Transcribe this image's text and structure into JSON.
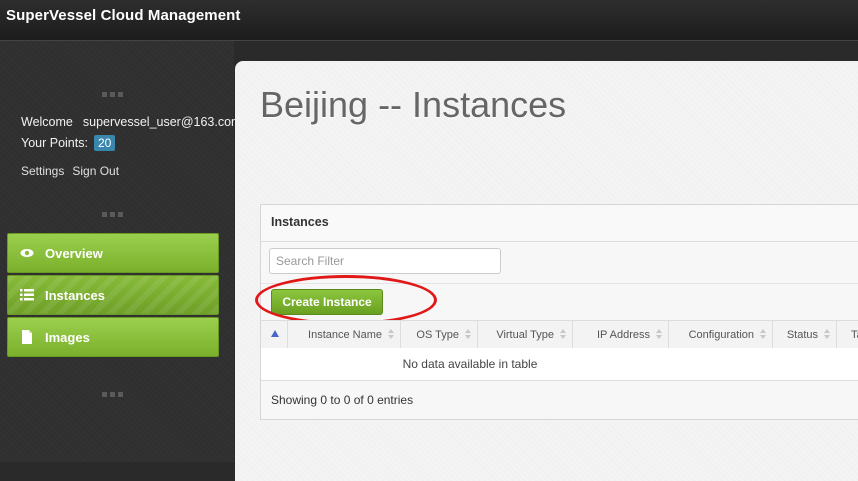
{
  "app": {
    "title": "SuperVessel Cloud Management"
  },
  "sidebar": {
    "welcome_label": "Welcome",
    "username": "supervessel_user@163.com",
    "points_label": "Your Points:",
    "points_value": "20",
    "settings_label": "Settings",
    "signout_label": "Sign Out",
    "nav": [
      {
        "label": "Overview",
        "icon": "eye-icon"
      },
      {
        "label": "Instances",
        "icon": "list-icon",
        "active": true
      },
      {
        "label": "Images",
        "icon": "document-icon"
      }
    ]
  },
  "main": {
    "title": "Beijing -- Instances",
    "panel": {
      "title": "Instances",
      "search_placeholder": "Search Filter",
      "create_label": "Create Instance",
      "columns": [
        "Instance Name",
        "OS Type",
        "Virtual Type",
        "IP Address",
        "Configuration",
        "Status",
        "Ta"
      ],
      "empty_message": "No data available in table",
      "info": "Showing 0 to 0 of 0 entries"
    }
  },
  "colors": {
    "nav_green": "#8cc63e",
    "badge_blue": "#3a87ad",
    "highlight_red": "#e01818"
  }
}
